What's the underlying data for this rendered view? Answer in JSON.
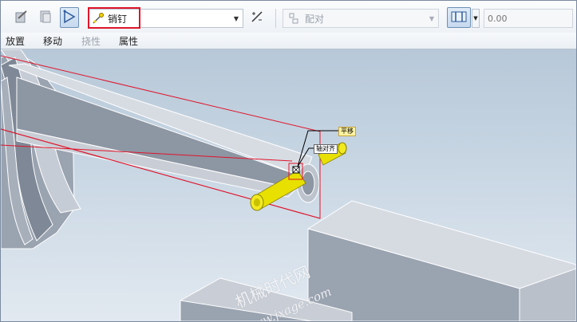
{
  "toolbar": {
    "constraint_set": {
      "value": "销钉",
      "icon": "pin-connection-icon"
    },
    "constraint_type": {
      "value": "配对",
      "icon": "mate-constraint-icon"
    },
    "offset": {
      "placeholder": "0.00"
    },
    "buttons": [
      {
        "icon": "user-defined-set-icon"
      },
      {
        "icon": "copy-set-icon"
      },
      {
        "icon": "add-set-icon"
      },
      {
        "icon": "flip-icon"
      },
      {
        "icon": "offset-type-icon"
      }
    ]
  },
  "tabs": [
    {
      "label": "放置",
      "enabled": true
    },
    {
      "label": "移动",
      "enabled": true
    },
    {
      "label": "挠性",
      "enabled": false
    },
    {
      "label": "属性",
      "enabled": true
    }
  ],
  "viewport": {
    "callouts": [
      {
        "label": "平移"
      },
      {
        "label": "轴对齐"
      }
    ],
    "watermark": {
      "line1": "机械时代网",
      "line2": "www.jxage.com"
    }
  },
  "colors": {
    "highlight": "#e0142a",
    "pin_yellow": "#e8e000",
    "part_gray": "#8d96a3",
    "background_top": "#b7c8d8"
  }
}
